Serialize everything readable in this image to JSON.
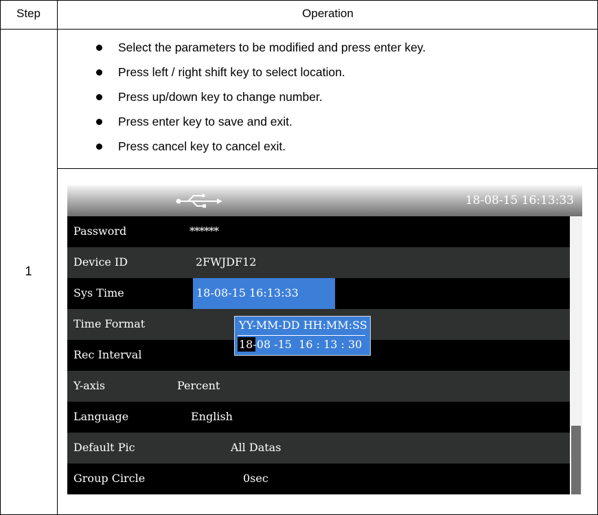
{
  "table": {
    "header_step": "Step",
    "header_operation": "Operation",
    "step_number": "1",
    "bullets": [
      "Select the parameters to be modified and press enter key.",
      "Press left / right shift key to select location.",
      "Press up/down key to change number.",
      "Press enter key to save and exit.",
      "Press cancel key to cancel exit."
    ]
  },
  "screen": {
    "usb_icon": "usb-icon",
    "clock": "18-08-15 16:13:33",
    "rows": [
      {
        "label": "Password",
        "value": "******"
      },
      {
        "label": "Device ID",
        "value": "2FWJDF12"
      },
      {
        "label": "Sys Time",
        "value": "18-08-15 16:13:33"
      },
      {
        "label": "Time Format",
        "value": ""
      },
      {
        "label": "Rec Interval",
        "value": ""
      },
      {
        "label": "Y-axis",
        "value": "Percent"
      },
      {
        "label": "Language",
        "value": "English"
      },
      {
        "label": "Default Pic",
        "value": "All Datas"
      },
      {
        "label": "Group Circle",
        "value": "0sec"
      }
    ],
    "popup": {
      "format": "YY-MM-DD HH:MM:SS",
      "cursor_value": "18",
      "edit_value": "-08 -15  16 : 13 : 30"
    },
    "colors": {
      "highlight": "#3c7fd9",
      "row_dark": "#000000",
      "row_gray": "#2e3130"
    }
  }
}
